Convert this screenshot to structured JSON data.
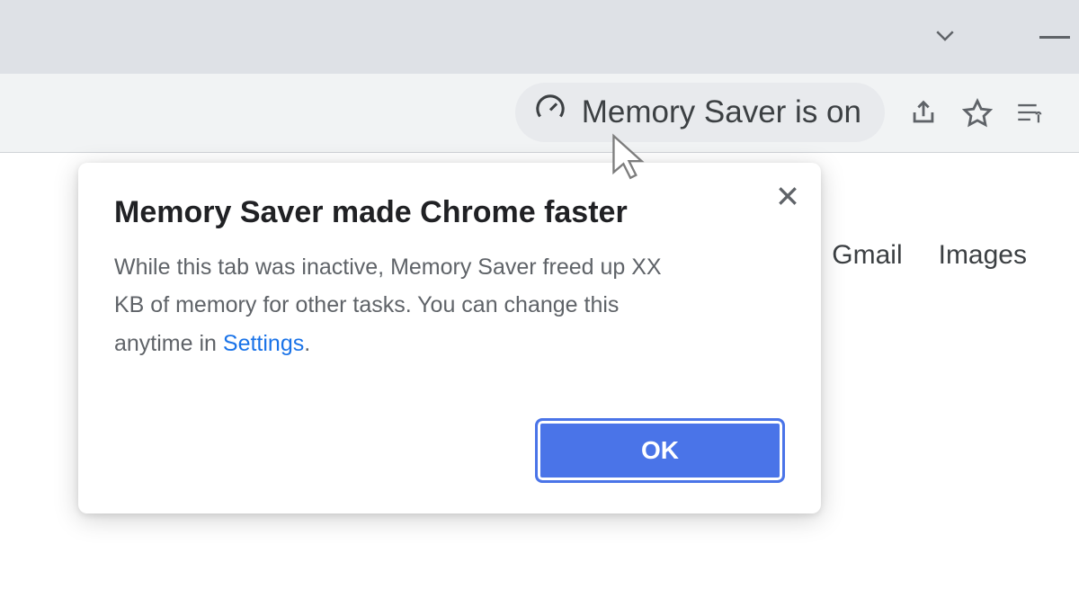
{
  "chip": {
    "label": "Memory Saver is on"
  },
  "page_nav": {
    "gmail": "Gmail",
    "images": "Images"
  },
  "popover": {
    "title": "Memory Saver made Chrome faster",
    "body_pre": "While this tab was inactive, Memory Saver freed up XX KB of memory for other tasks. You can change this anytime in ",
    "settings_link": "Settings",
    "body_post": ".",
    "ok": "OK"
  }
}
